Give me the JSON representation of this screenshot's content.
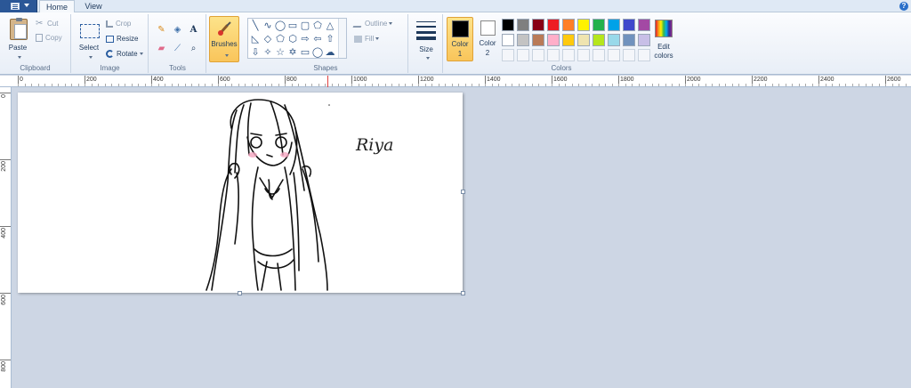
{
  "tabs": {
    "home": "Home",
    "view": "View"
  },
  "help": "?",
  "clipboard": {
    "paste": "Paste",
    "cut": "Cut",
    "copy": "Copy",
    "label": "Clipboard"
  },
  "image": {
    "select": "Select",
    "crop": "Crop",
    "resize": "Resize",
    "rotate": "Rotate",
    "label": "Image"
  },
  "tools": {
    "label": "Tools"
  },
  "brushes": {
    "label": "Brushes"
  },
  "shapes": {
    "outline": "Outline",
    "fill": "Fill",
    "label": "Shapes"
  },
  "size": {
    "label": "Size"
  },
  "colors": {
    "color1_label": "Color",
    "color1_num": "1",
    "color2_label": "Color",
    "color2_num": "2",
    "edit_label": "Edit",
    "edit_label2": "colors",
    "label": "Colors",
    "row1": [
      "#000000",
      "#7f7f7f",
      "#880015",
      "#ed1c24",
      "#ff7f27",
      "#fff200",
      "#22b14c",
      "#00a2e8",
      "#3f48cc",
      "#a349a4"
    ],
    "row2": [
      "#ffffff",
      "#c3c3c3",
      "#b97a57",
      "#ffaec9",
      "#ffc90e",
      "#efe4b0",
      "#b5e61d",
      "#99d9ea",
      "#7092be",
      "#c8bfe7"
    ]
  },
  "ruler": {
    "h": [
      "0",
      "200",
      "400",
      "600",
      "800",
      "1000",
      "1200",
      "1400",
      "1600",
      "1800",
      "2000",
      "2200",
      "2400",
      "2600"
    ],
    "v": [
      "0",
      "200",
      "400",
      "600",
      "800"
    ]
  },
  "canvas": {
    "signature": "Riya"
  }
}
